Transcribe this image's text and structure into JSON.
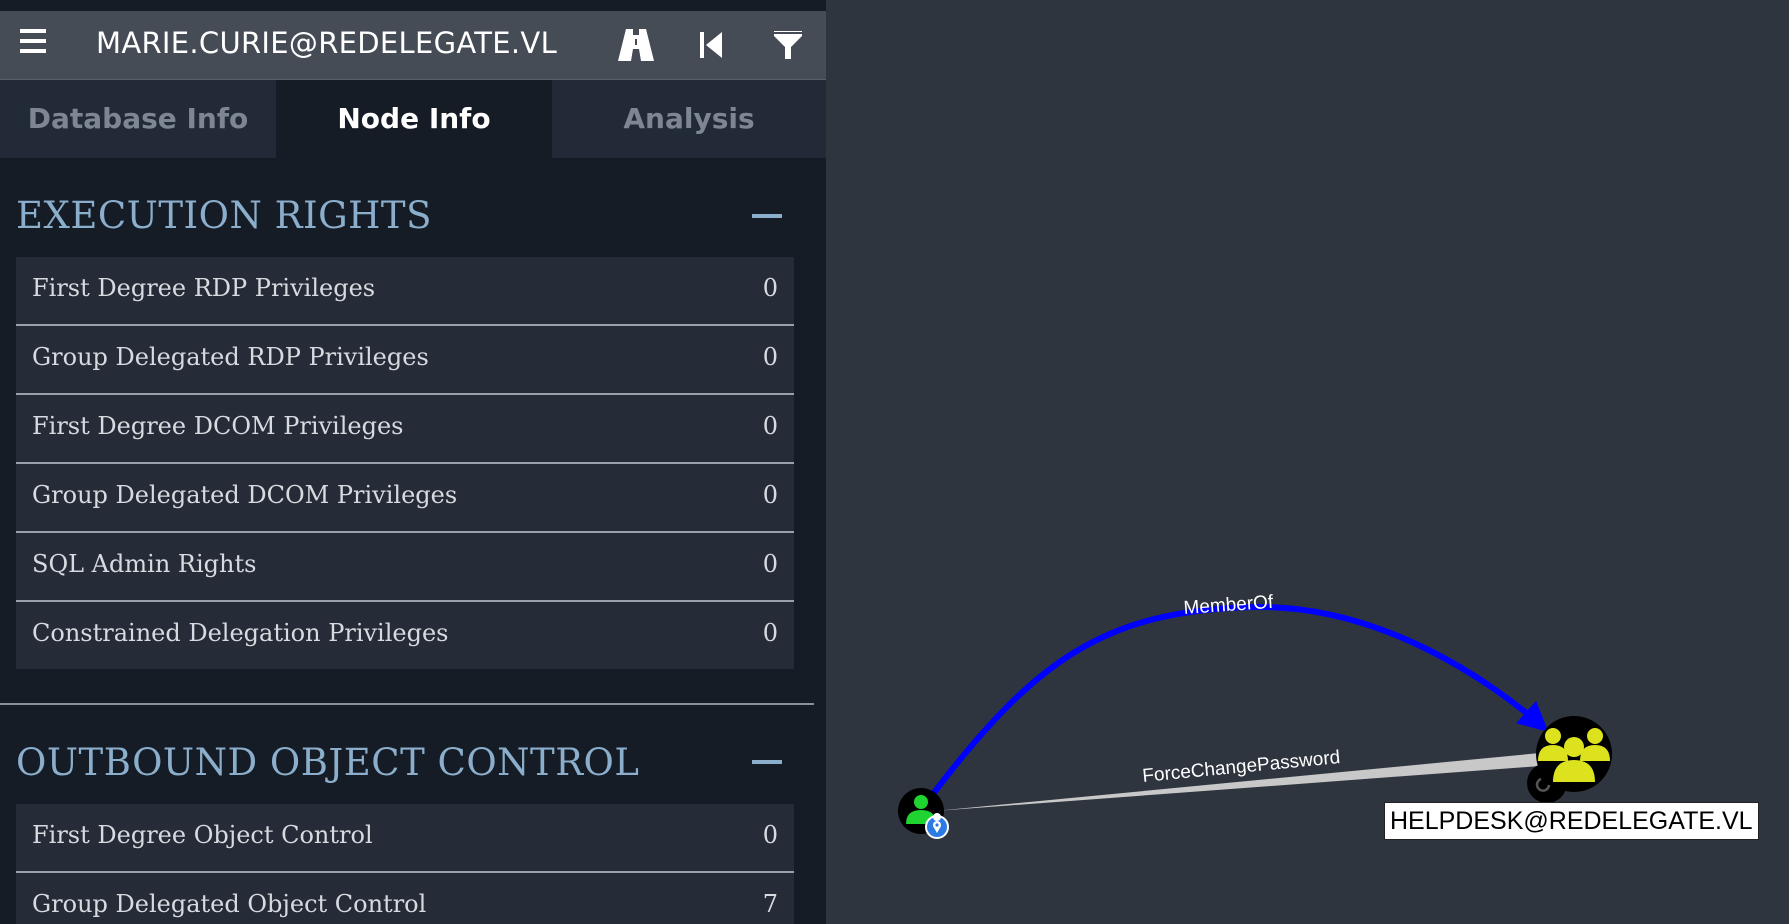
{
  "header": {
    "node_title": "MARIE.CURIE@REDELEGATE.VL",
    "icons": [
      "menu-icon",
      "pathfinding-icon",
      "back-icon",
      "filter-icon"
    ]
  },
  "tabs": [
    {
      "label": "Database Info",
      "active": false
    },
    {
      "label": "Node Info",
      "active": true
    },
    {
      "label": "Analysis",
      "active": false
    }
  ],
  "sections": {
    "execution_rights": {
      "title": "EXECUTION RIGHTS",
      "rows": [
        {
          "label": "First Degree RDP Privileges",
          "count": "0"
        },
        {
          "label": "Group Delegated RDP Privileges",
          "count": "0"
        },
        {
          "label": "First Degree DCOM Privileges",
          "count": "0"
        },
        {
          "label": "Group Delegated DCOM Privileges",
          "count": "0"
        },
        {
          "label": "SQL Admin Rights",
          "count": "0"
        },
        {
          "label": "Constrained Delegation Privileges",
          "count": "0"
        }
      ]
    },
    "outbound_object_control": {
      "title": "OUTBOUND OBJECT CONTROL",
      "rows": [
        {
          "label": "First Degree Object Control",
          "count": "0"
        },
        {
          "label": "Group Delegated Object Control",
          "count": "7"
        }
      ]
    }
  },
  "graph": {
    "edges": [
      {
        "label": "MemberOf",
        "color": "#0000ff"
      },
      {
        "label": "ForceChangePassword",
        "color": "#c0c0c0"
      }
    ],
    "nodes": [
      {
        "type": "user",
        "icon": "user-icon",
        "color": "#1fd331"
      },
      {
        "type": "group",
        "icon": "group-icon",
        "color": "#dde21f",
        "label": "HELPDESK@REDELEGATE.VL"
      }
    ]
  },
  "colors": {
    "accent": "#8aaecb",
    "panel_bg": "#161c26",
    "graph_bg": "#2f353f"
  }
}
